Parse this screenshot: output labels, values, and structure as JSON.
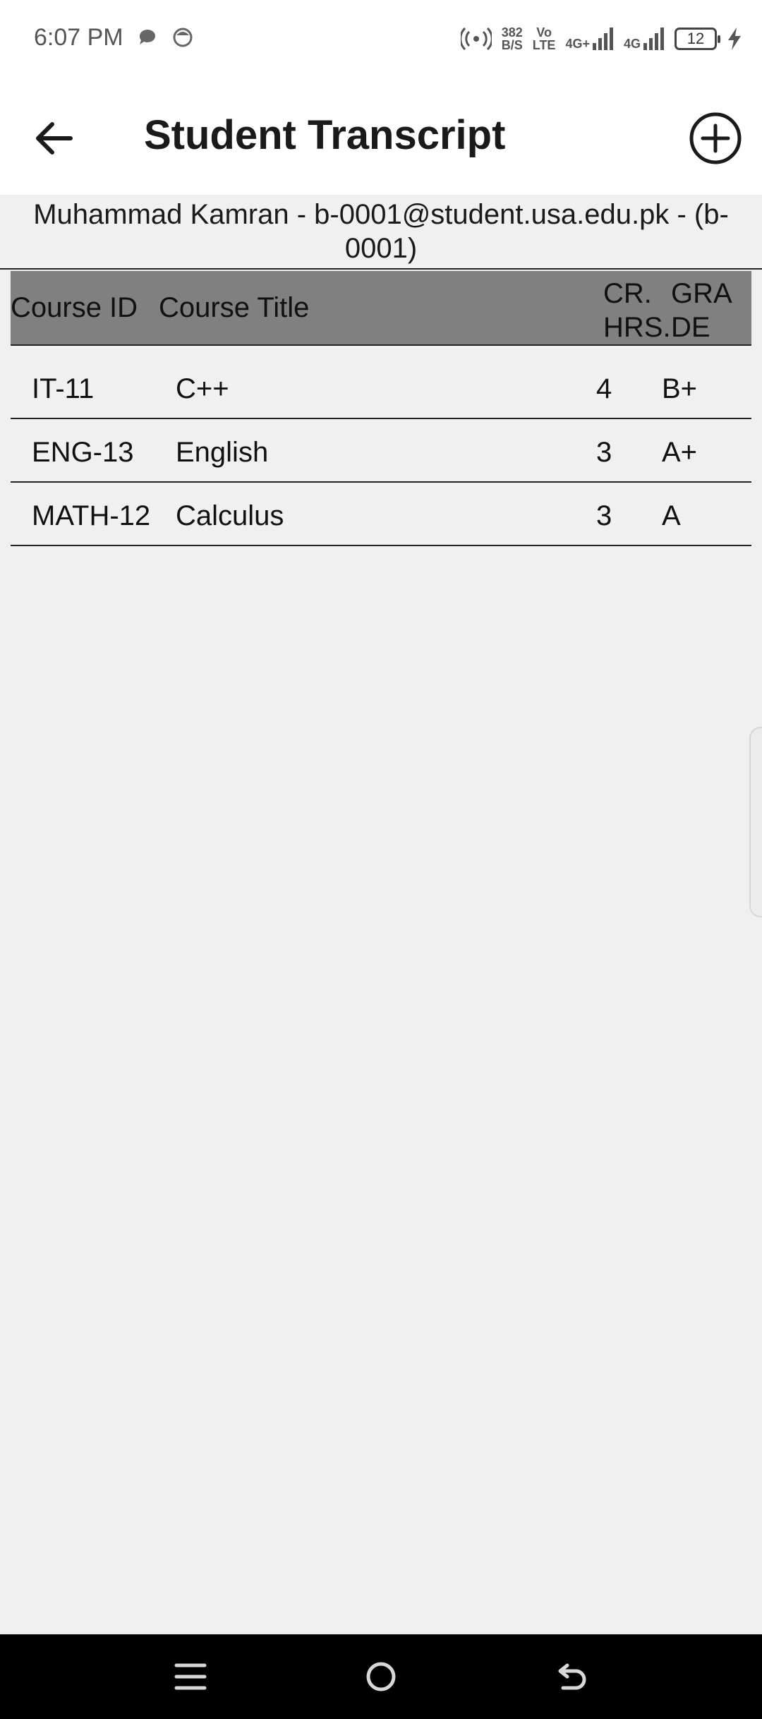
{
  "status_bar": {
    "time": "6:07 PM",
    "data_speed": "382",
    "data_speed_unit": "B/S",
    "volte_top": "Vo",
    "volte_bottom": "LTE",
    "network_1": "4G+",
    "network_2": "4G",
    "battery_level": "12",
    "icons": [
      "chat-bubble-icon",
      "smiley-icon",
      "hotspot-icon",
      "signal-bars-icon",
      "battery-icon",
      "charging-bolt-icon"
    ]
  },
  "app_bar": {
    "title": "Student Transcript",
    "back_icon": "arrow-left-icon",
    "add_icon": "plus-circle-icon"
  },
  "student": {
    "info": "Muhammad Kamran - b-0001@student.usa.edu.pk - (b-0001)"
  },
  "table": {
    "headers": {
      "course_id": "Course ID",
      "course_title": "Course Title",
      "credit_hours": "CR. HRS.",
      "grade": "GRADE"
    },
    "rows": [
      {
        "course_id": "IT-11",
        "course_title": "C++",
        "credit_hours": "4",
        "grade": "B+"
      },
      {
        "course_id": "ENG-13",
        "course_title": "English",
        "credit_hours": "3",
        "grade": "A+"
      },
      {
        "course_id": "MATH-12",
        "course_title": "Calculus",
        "credit_hours": "3",
        "grade": "A"
      }
    ]
  },
  "nav_bar": {
    "icons": [
      "menu-icon",
      "home-icon",
      "back-nav-icon"
    ]
  },
  "colors": {
    "header_row": "#808080",
    "background": "#f0f0f0",
    "app_bar": "#ffffff",
    "nav_bar": "#000000"
  }
}
